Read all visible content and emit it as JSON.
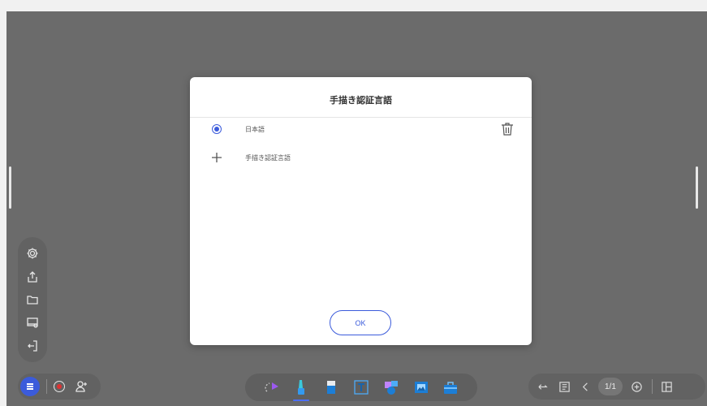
{
  "dialog": {
    "title": "手描き認証言語",
    "languages": [
      {
        "label": "日本語",
        "selected": true
      }
    ],
    "add_label": "手描き認証言語",
    "ok_label": "OK"
  },
  "left_panel": {
    "icons": [
      "settings-icon",
      "export-icon",
      "folder-icon",
      "save-board-icon",
      "exit-icon"
    ]
  },
  "bottom_left": {
    "icons": [
      "menu-icon",
      "record-icon",
      "add-user-icon"
    ]
  },
  "tool_tray": {
    "tools": [
      "lasso-select-icon",
      "pen-icon",
      "eraser-icon",
      "text-icon",
      "shapes-icon",
      "image-icon",
      "toolbox-icon"
    ],
    "active_tool": "pen-icon"
  },
  "bottom_right": {
    "page_indicator": "1/1",
    "icons": [
      "undo-icon",
      "page-list-icon",
      "prev-page-icon",
      "add-page-icon",
      "layout-icon"
    ]
  },
  "colors": {
    "accent": "#3b5bdb",
    "canvas": "#6b6b6b",
    "record": "#e03131"
  }
}
